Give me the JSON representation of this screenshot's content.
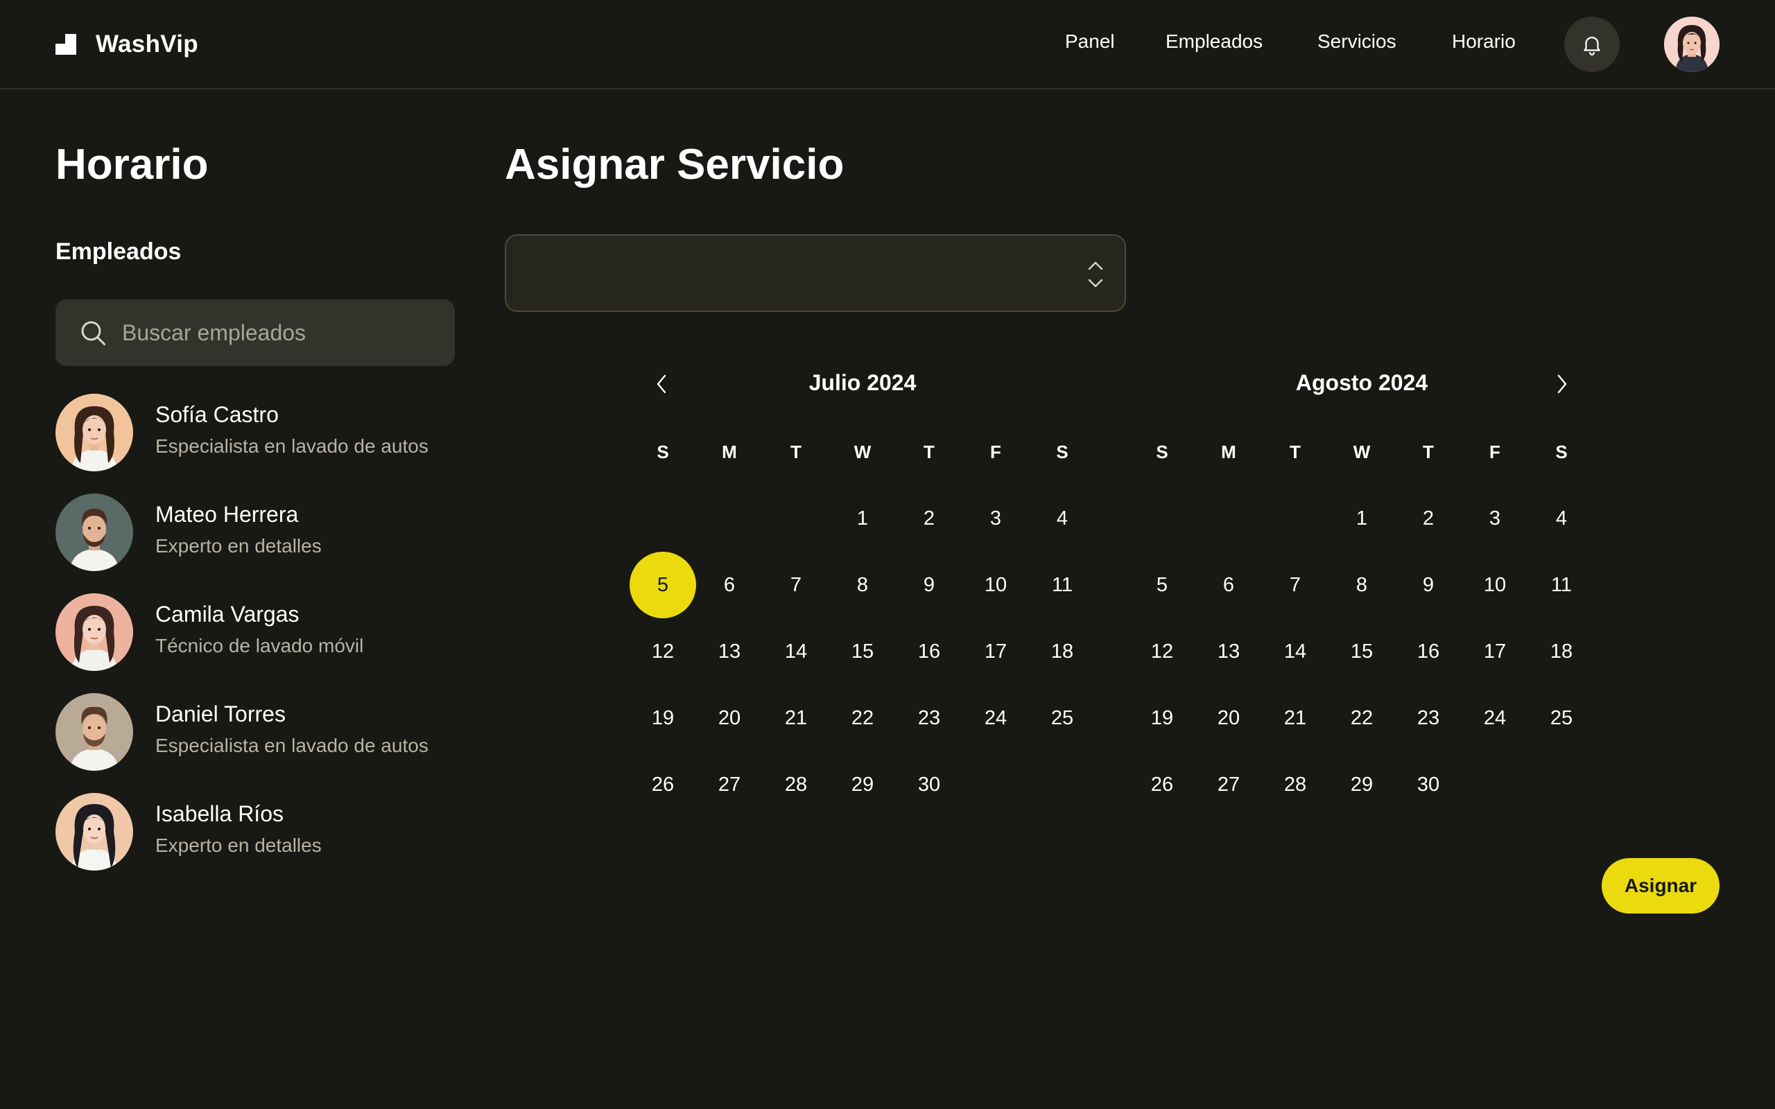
{
  "app": {
    "name": "WashVip",
    "logo_icon": "logo-mark"
  },
  "nav": {
    "items": [
      "Panel",
      "Empleados",
      "Servicios",
      "Horario"
    ]
  },
  "header": {
    "bell_icon": "bell-icon",
    "avatar": "user-avatar"
  },
  "colors": {
    "background": "#181814",
    "accent": "#ebdb0e",
    "surface": "#33332b",
    "muted_text": "#b7b4a4"
  },
  "left": {
    "title": "Horario",
    "section_label": "Empleados",
    "search_placeholder": "Buscar empleados",
    "employees": [
      {
        "name": "Sofía Castro",
        "role": "Especialista en lavado de autos"
      },
      {
        "name": "Mateo Herrera",
        "role": "Experto en detalles"
      },
      {
        "name": "Camila Vargas",
        "role": "Técnico de lavado móvil"
      },
      {
        "name": "Daniel Torres",
        "role": "Especialista en lavado de autos"
      },
      {
        "name": "Isabella Ríos",
        "role": "Experto en detalles"
      }
    ]
  },
  "right": {
    "title": "Asignar Servicio",
    "select_value": "",
    "assign_label": "Asignar",
    "selected_day": "5"
  },
  "calendar": {
    "weekdays": [
      "S",
      "M",
      "T",
      "W",
      "T",
      "F",
      "S"
    ],
    "months": [
      {
        "title": "Julio 2024",
        "weeks": [
          [
            "",
            "",
            "",
            "1",
            "2",
            "3",
            "4"
          ],
          [
            "5",
            "6",
            "7",
            "8",
            "9",
            "10",
            "11"
          ],
          [
            "12",
            "13",
            "14",
            "15",
            "16",
            "17",
            "18"
          ],
          [
            "19",
            "20",
            "21",
            "22",
            "23",
            "24",
            "25"
          ],
          [
            "26",
            "27",
            "28",
            "29",
            "30",
            "",
            ""
          ]
        ]
      },
      {
        "title": "Agosto 2024",
        "weeks": [
          [
            "",
            "",
            "",
            "1",
            "2",
            "3",
            "4"
          ],
          [
            "5",
            "6",
            "7",
            "8",
            "9",
            "10",
            "11"
          ],
          [
            "12",
            "13",
            "14",
            "15",
            "16",
            "17",
            "18"
          ],
          [
            "19",
            "20",
            "21",
            "22",
            "23",
            "24",
            "25"
          ],
          [
            "26",
            "27",
            "28",
            "29",
            "30",
            "",
            ""
          ]
        ]
      }
    ]
  }
}
